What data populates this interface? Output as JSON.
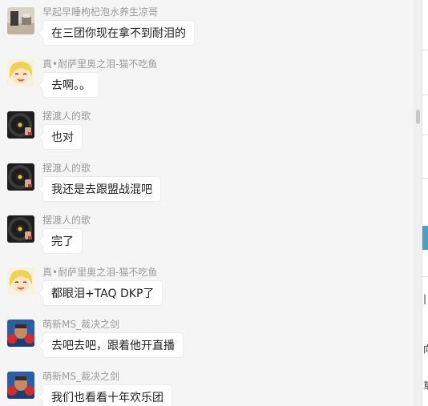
{
  "messages": [
    {
      "sender": "早起早睡枸杞泡水养生凉哥",
      "text": "在三团你现在拿不到耐泪的",
      "avatar": "desk-photo-avatar"
    },
    {
      "sender": "真•耐萨里奥之泪-猫不吃鱼",
      "text": "去啊。。",
      "avatar": "anime-blonde-avatar"
    },
    {
      "sender": "摆渡人的歌",
      "text": "也对",
      "avatar": "steering-wheel-avatar"
    },
    {
      "sender": "摆渡人的歌",
      "text": "我还是去跟盟战混吧",
      "avatar": "steering-wheel-avatar"
    },
    {
      "sender": "摆渡人的歌",
      "text": "完了",
      "avatar": "steering-wheel-avatar"
    },
    {
      "sender": "真•耐萨里奥之泪-猫不吃鱼",
      "text": "都眼泪+TAQ DKP了",
      "avatar": "anime-blonde-avatar"
    },
    {
      "sender": "萌新MS_裁决之剑",
      "text": "去吧去吧，跟着他开直播",
      "avatar": "boxer-avatar"
    },
    {
      "sender": "萌新MS_裁决之剑",
      "text": "我们也看看十年欢乐团",
      "avatar": "boxer-avatar"
    }
  ],
  "right_pane": {
    "glyphs": [
      "|",
      "向",
      "草"
    ]
  }
}
